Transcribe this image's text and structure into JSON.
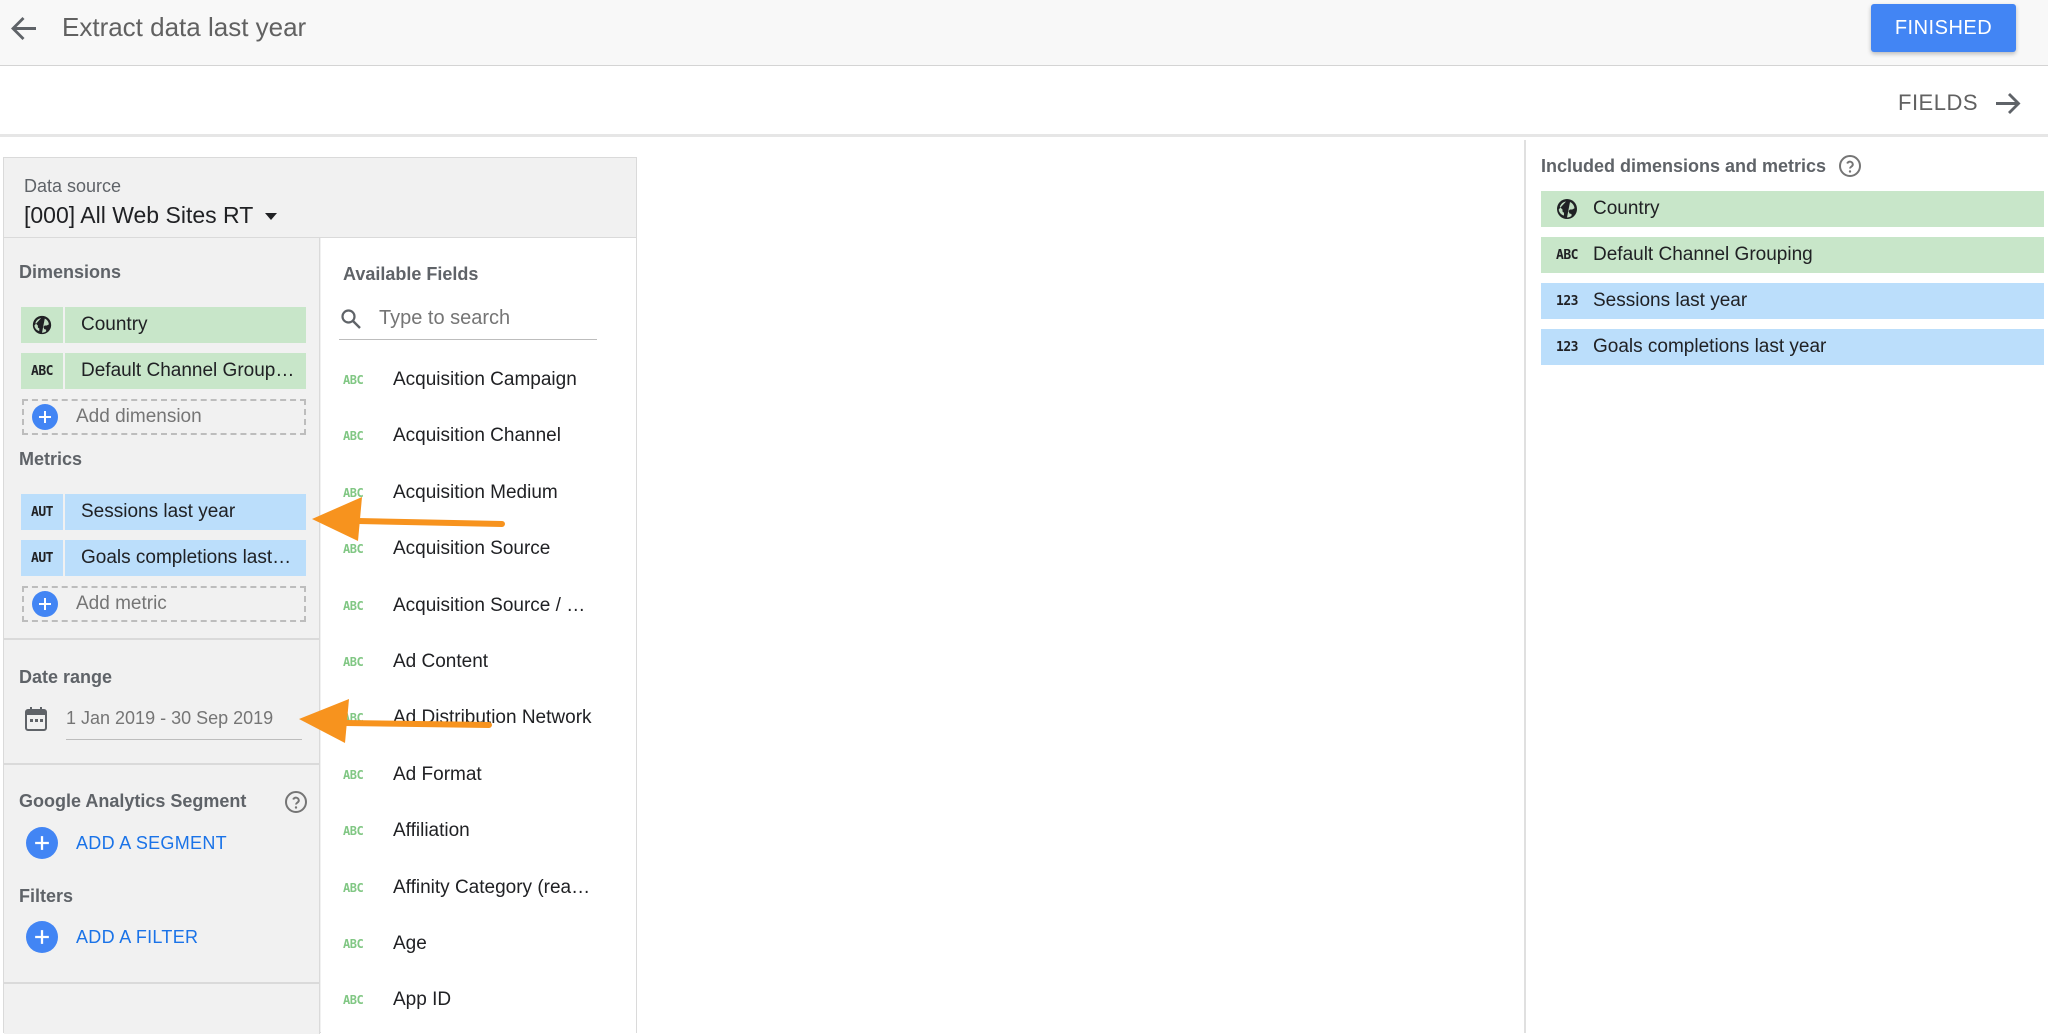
{
  "header": {
    "title": "Extract data last year",
    "finished_label": "FINISHED",
    "fields_label": "FIELDS"
  },
  "data_source": {
    "label": "Data source",
    "value": "[000] All Web Sites RT"
  },
  "config": {
    "dimensions_label": "Dimensions",
    "dimensions": [
      {
        "type": "globe",
        "label": "Country"
      },
      {
        "type": "ABC",
        "label": "Default Channel Group…"
      }
    ],
    "add_dimension": "Add dimension",
    "metrics_label": "Metrics",
    "metrics": [
      {
        "type": "AUT",
        "label": "Sessions last year"
      },
      {
        "type": "AUT",
        "label": "Goals completions last…"
      }
    ],
    "add_metric": "Add metric",
    "date_range_label": "Date range",
    "date_range_value": "1 Jan 2019 - 30 Sep 2019",
    "segment_label": "Google Analytics Segment",
    "add_segment": "ADD A SEGMENT",
    "filters_label": "Filters",
    "add_filter": "ADD A FILTER"
  },
  "available_fields": {
    "label": "Available Fields",
    "search_placeholder": "Type to search",
    "items": [
      {
        "type": "ABC",
        "name": "Acquisition Campaign"
      },
      {
        "type": "ABC",
        "name": "Acquisition Channel"
      },
      {
        "type": "ABC",
        "name": "Acquisition Medium"
      },
      {
        "type": "ABC",
        "name": "Acquisition Source"
      },
      {
        "type": "ABC",
        "name": "Acquisition Source / M…"
      },
      {
        "type": "ABC",
        "name": "Ad Content"
      },
      {
        "type": "ABC",
        "name": "Ad Distribution Network"
      },
      {
        "type": "ABC",
        "name": "Ad Format"
      },
      {
        "type": "ABC",
        "name": "Affiliation"
      },
      {
        "type": "ABC",
        "name": "Affinity Category (reach)"
      },
      {
        "type": "ABC",
        "name": "Age"
      },
      {
        "type": "ABC",
        "name": "App ID"
      }
    ]
  },
  "included": {
    "label": "Included dimensions and metrics",
    "items": [
      {
        "type": "globe",
        "label": "Country",
        "kind": "dimension"
      },
      {
        "type": "ABC",
        "label": "Default Channel Grouping",
        "kind": "dimension"
      },
      {
        "type": "123",
        "label": "Sessions last year",
        "kind": "metric"
      },
      {
        "type": "123",
        "label": "Goals completions last year",
        "kind": "metric"
      }
    ]
  },
  "colors": {
    "primary": "#4285f4",
    "dimension_chip": "#c8e6c9",
    "metric_chip": "#bbdefb",
    "annotation_arrow": "#f7931e"
  }
}
